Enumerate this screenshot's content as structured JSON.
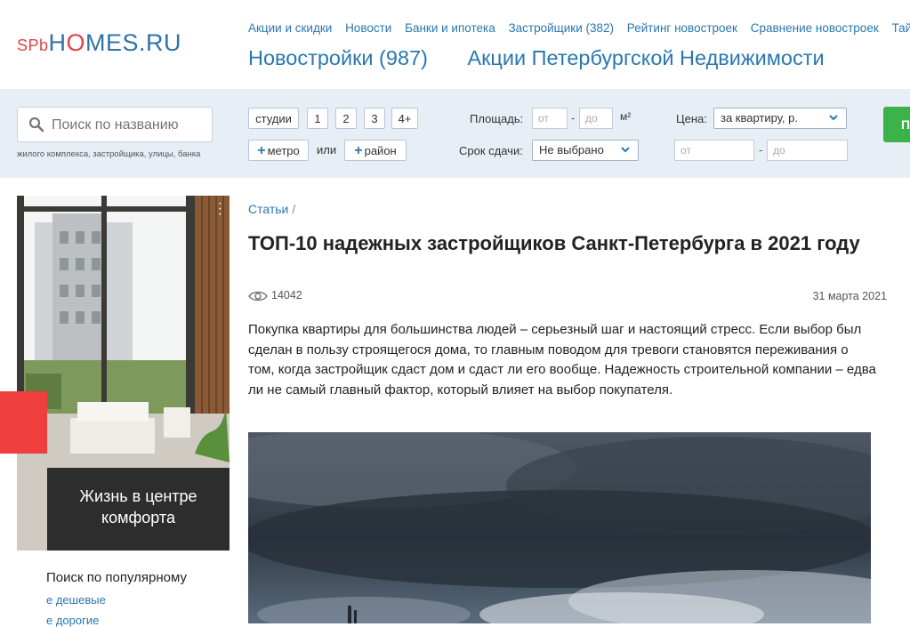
{
  "header": {
    "logo_prefix": "SPb",
    "logo_a": "H",
    "logo_o": "O",
    "logo_b": "MES.RU",
    "top_links": [
      "Акции и скидки",
      "Новости",
      "Банки и ипотека",
      "Застройщики (382)",
      "Рейтинг новостроек",
      "Сравнение новостроек",
      "Тай"
    ],
    "big_links": [
      "Новостройки (987)",
      "Акции Петербургской Недвижимости"
    ]
  },
  "filters": {
    "search_placeholder": "Поиск по названию",
    "search_hint": "жилого комплекса, застройщика, улицы, банка",
    "rooms": [
      "студии",
      "1",
      "2",
      "3",
      "4+"
    ],
    "metro_label": "метро",
    "or_label": "или",
    "district_label": "район",
    "area_label": "Площадь:",
    "area_from": "от",
    "area_to": "до",
    "area_unit": "м²",
    "deadline_label": "Срок сдачи:",
    "deadline_value": "Не выбрано",
    "price_label": "Цена:",
    "price_value": "за квартиру, р.",
    "price_from": "от",
    "price_to": "до",
    "submit_label": "П",
    "dash": "-"
  },
  "ad": {
    "caption_line1": "Жизнь в центре",
    "caption_line2": "комфорта"
  },
  "sidebar": {
    "popular_title": "Поиск по популярному",
    "links": [
      "е дешевые",
      "е дорогие"
    ]
  },
  "article": {
    "breadcrumb": "Статьи",
    "breadcrumb_sep": "/",
    "title": "ТОП-10 надежных застройщиков Санкт-Петербурга в 2021 году",
    "views": "14042",
    "date": "31 марта 2021",
    "intro": "Покупка квартиры для большинства людей – серьезный шаг и настоящий стресс. Если выбор был сделан в пользу строящегося дома, то главным поводом для тревоги становятся переживания о том, когда застройщик сдаст дом и сдаст ли его вообще. Надежность строительной компании – едва ли не самый главный фактор, который влияет на выбор покупателя."
  },
  "colors": {
    "link": "#2a77b0",
    "logo_red": "#e04343",
    "filter_bg": "#e8eef6",
    "button_green": "#3cb24a"
  }
}
